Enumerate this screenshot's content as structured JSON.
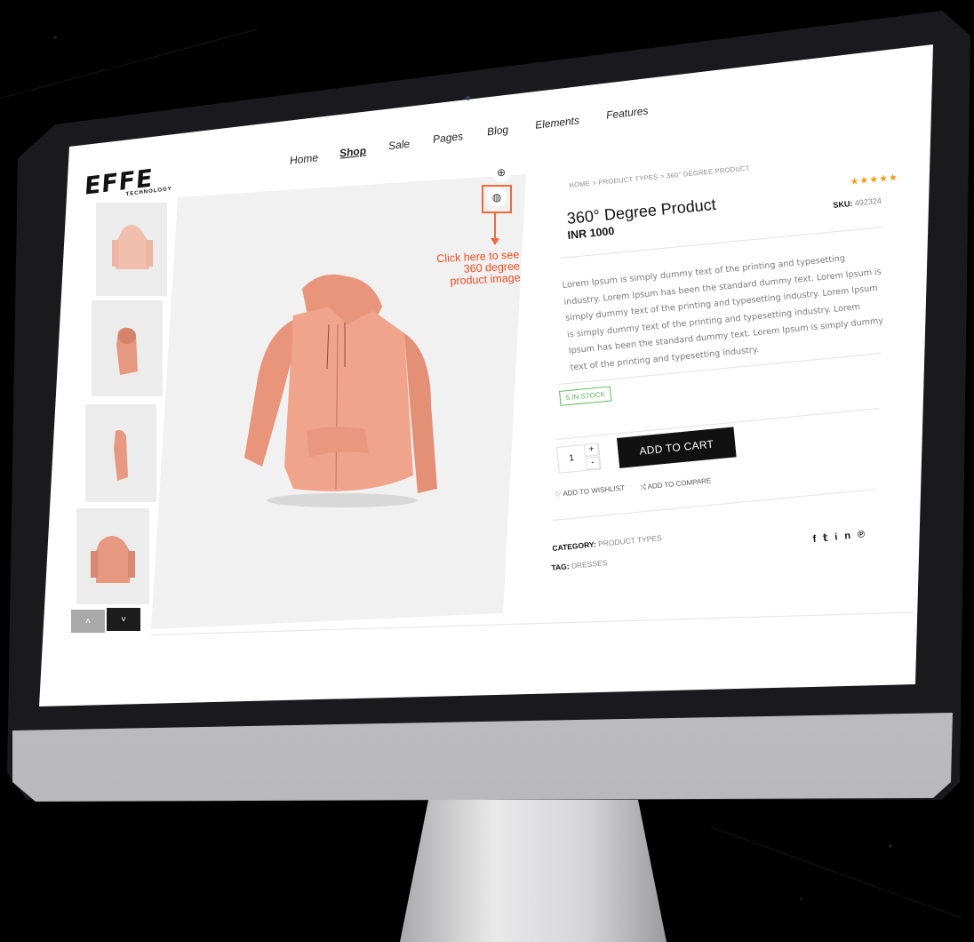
{
  "nav": {
    "items": [
      "Home",
      "Shop",
      "Sale",
      "Pages",
      "Blog",
      "Elements",
      "Features"
    ],
    "active": "Shop"
  },
  "logo": {
    "main": "EFFE",
    "sub": "TECHNOLOGY"
  },
  "gallery": {
    "zoom_icon": "⊕",
    "view360_icon": "◍",
    "annotation": "Click here to see 360 degree product image",
    "up_icon": "˄",
    "down_icon": "˅"
  },
  "product": {
    "breadcrumb": "HOME  >  PRODUCT TYPES  >  360° DEGREE PRODUCT",
    "title": "360° Degree Product",
    "price": "INR 1000",
    "stars": "★★★★★",
    "sku_label": "SKU:",
    "sku_value": "492324",
    "description": "Lorem Ipsum is simply dummy text of the printing and typesetting industry. Lorem Ipsum has been the standard dummy text. Lorem Ipsum is simply dummy text of the printing and typesetting industry. Lorem Ipsum is simply dummy text of the printing and typesetting industry. Lorem Ipsum has been the standard dummy text. Lorem Ipsum is simply dummy text of the printing and typesetting industry.",
    "stock": "5 IN STOCK",
    "quantity": "1",
    "plus": "+",
    "minus": "-",
    "add_to_cart": "ADD TO CART",
    "wishlist": "♡ ADD TO WISHLIST",
    "compare": "⤭ ADD TO COMPARE",
    "category_label": "CATEGORY:",
    "category_value": "PRODUCT TYPES",
    "tag_label": "TAG:",
    "tag_value": "DRESSES",
    "social": [
      "f",
      "𝕥",
      "in",
      "℗"
    ]
  },
  "colors": {
    "accent": "#ef6a3a",
    "stock": "#5cb85c",
    "stars": "#f39c12",
    "hoodie": "#f0a48b"
  }
}
